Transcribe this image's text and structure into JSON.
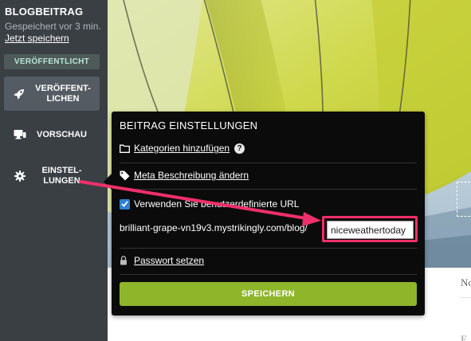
{
  "sidebar": {
    "title": "BLOGBEITRAG",
    "saved_text": "Gespeichert vor 3 min.",
    "save_now_link": "Jetzt speichern",
    "status_badge": "VERÖFFENTLICHT",
    "publish_button_line1": "VERÖFFENT-",
    "publish_button_line2": "LICHEN",
    "preview_label": "VORSCHAU",
    "settings_label_line1": "EINSTEL-",
    "settings_label_line2": "LUNGEN",
    "icons": [
      "rocket-icon",
      "monitor-icon",
      "gear-icon"
    ]
  },
  "panel": {
    "title": "BEITRAG EINSTELLUNGEN",
    "categories_link": "Kategorien hinzufügen",
    "meta_link": "Meta Beschreibung ändern",
    "custom_url_label": "Verwenden Sie benutzerdefinierte URL",
    "custom_url_checked": true,
    "url_prefix": "brilliant-grape-vn19v3.mystrikingly.com/blog/",
    "url_slug_value": "niceweathertoday",
    "password_link": "Passwort setzen",
    "save_button": "SPEICHERN",
    "icons": [
      "folder-icon",
      "help-icon",
      "tag-icon",
      "checkbox-icon",
      "lock-icon"
    ]
  },
  "page_peek": {
    "text_1": "No",
    "text_2": "E"
  },
  "colors": {
    "sidebar_bg": "#3a3f44",
    "panel_bg": "#0b0b0b",
    "save_button": "#8fb62a",
    "annotation": "#ef2f6b",
    "checkbox": "#2f7fd0"
  }
}
